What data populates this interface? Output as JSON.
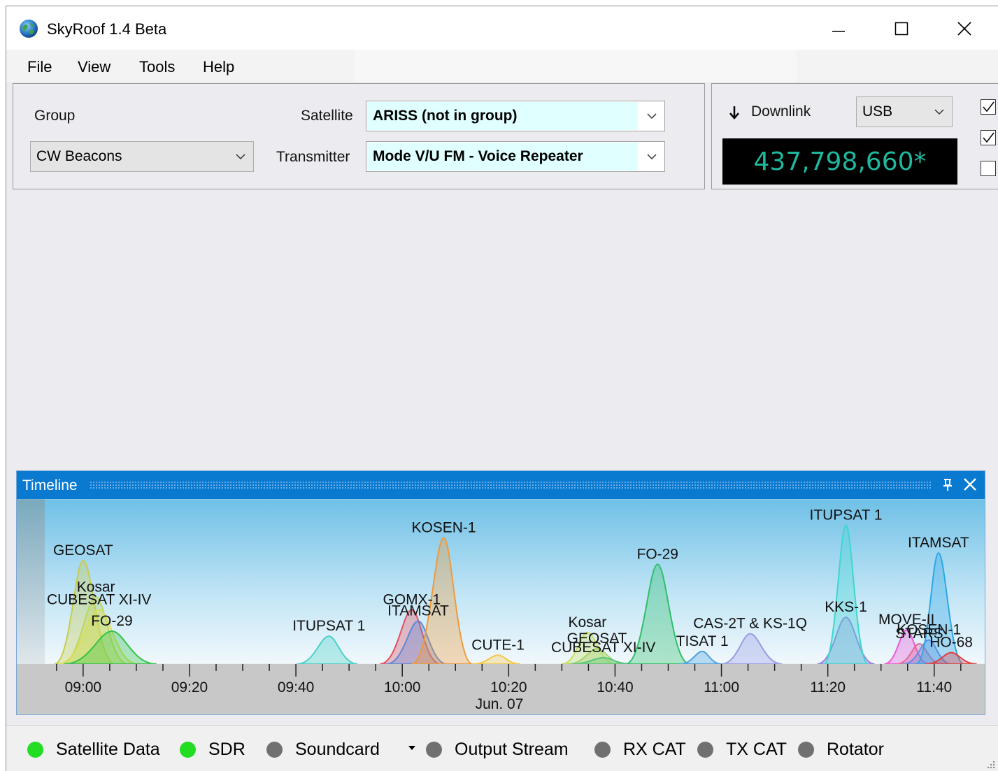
{
  "window": {
    "title": "SkyRoof 1.4 Beta"
  },
  "menu": [
    "File",
    "View",
    "Tools",
    "Help"
  ],
  "satellite_panel": {
    "group_label": "Group",
    "group_value": "CW Beacons",
    "satellite_label": "Satellite",
    "satellite_value": "ARISS (not in group)",
    "transmitter_label": "Transmitter",
    "transmitter_value": "Mode V/U FM - Voice Repeater"
  },
  "downlink_panel": {
    "label": "Downlink",
    "mode_value": "USB",
    "frequency": "437,798,660*",
    "checkboxes": [
      true,
      true,
      false
    ]
  },
  "timeline": {
    "title": "Timeline",
    "time_labels": [
      "09:00",
      "09:20",
      "09:40",
      "10:00",
      "10:20",
      "10:40",
      "11:00",
      "11:20",
      "11:40"
    ],
    "date_label": "Jun. 07",
    "passes": [
      {
        "name": "GEOSAT",
        "start": 8.91,
        "peak": 9.0,
        "end": 9.1,
        "elev": 0.82,
        "color": "#c8cc4a"
      },
      {
        "name": "Kosar",
        "start": 8.93,
        "peak": 9.04,
        "end": 9.14,
        "elev": 0.53,
        "color": "#b9d85a"
      },
      {
        "name": "CUBESAT XI-IV",
        "start": 8.92,
        "peak": 9.05,
        "end": 9.17,
        "elev": 0.43,
        "color": "#d8e05a"
      },
      {
        "name": "FO-29",
        "start": 8.94,
        "peak": 9.09,
        "end": 9.23,
        "elev": 0.26,
        "color": "#35c24a"
      },
      {
        "name": "ITUPSAT 1",
        "start": 9.67,
        "peak": 9.77,
        "end": 9.86,
        "elev": 0.22,
        "color": "#4bd0c7"
      },
      {
        "name": "GOMX-1",
        "start": 9.93,
        "peak": 10.03,
        "end": 10.12,
        "elev": 0.43,
        "color": "#e05060"
      },
      {
        "name": "ITAMSAT",
        "start": 9.95,
        "peak": 10.05,
        "end": 10.14,
        "elev": 0.34,
        "color": "#5d88d8"
      },
      {
        "name": "KOSEN-1",
        "start": 10.03,
        "peak": 10.13,
        "end": 10.22,
        "elev": 1.0,
        "color": "#f09a3a"
      },
      {
        "name": "CUTE-1",
        "start": 10.22,
        "peak": 10.3,
        "end": 10.37,
        "elev": 0.07,
        "color": "#f3c94a"
      },
      {
        "name": "Kosar",
        "start": 10.5,
        "peak": 10.58,
        "end": 10.67,
        "elev": 0.25,
        "color": "#c7e060"
      },
      {
        "name": "GEOSAT",
        "start": 10.52,
        "peak": 10.61,
        "end": 10.7,
        "elev": 0.12,
        "color": "#a4d26a"
      },
      {
        "name": "CUBESAT XI-IV",
        "start": 10.53,
        "peak": 10.63,
        "end": 10.72,
        "elev": 0.05,
        "color": "#57c57b"
      },
      {
        "name": "FO-29",
        "start": 10.7,
        "peak": 10.8,
        "end": 10.9,
        "elev": 0.79,
        "color": "#2fbf6a"
      },
      {
        "name": "TISAT 1",
        "start": 10.87,
        "peak": 10.94,
        "end": 11.0,
        "elev": 0.1,
        "color": "#4ca3e0"
      },
      {
        "name": "CAS-2T & KS-1Q",
        "start": 11.0,
        "peak": 11.09,
        "end": 11.19,
        "elev": 0.24,
        "color": "#9b9be6"
      },
      {
        "name": "KKS-1",
        "start": 11.3,
        "peak": 11.39,
        "end": 11.48,
        "elev": 0.37,
        "color": "#9a82e0"
      },
      {
        "name": "ITUPSAT 1",
        "start": 11.32,
        "peak": 11.39,
        "end": 11.46,
        "elev": 1.1,
        "color": "#3ed6d0"
      },
      {
        "name": "MOVE-II",
        "start": 11.51,
        "peak": 11.58,
        "end": 11.65,
        "elev": 0.27,
        "color": "#ec5ad8"
      },
      {
        "name": "STARS",
        "start": 11.55,
        "peak": 11.62,
        "end": 11.69,
        "elev": 0.16,
        "color": "#e06a9a"
      },
      {
        "name": "KOSEN-1",
        "start": 11.57,
        "peak": 11.65,
        "end": 11.72,
        "elev": 0.19,
        "color": "#6b8be0"
      },
      {
        "name": "ITAMSAT",
        "start": 11.61,
        "peak": 11.68,
        "end": 11.76,
        "elev": 0.88,
        "color": "#2fa6e6"
      },
      {
        "name": "HO-68",
        "start": 11.64,
        "peak": 11.72,
        "end": 11.8,
        "elev": 0.09,
        "color": "#e04040"
      }
    ]
  },
  "status": [
    {
      "label": "Satellite Data",
      "color": "#22dd22"
    },
    {
      "label": "SDR",
      "color": "#22dd22"
    },
    {
      "label": "Soundcard",
      "color": "#707070"
    },
    {
      "label": "Output Stream",
      "color": "#707070"
    },
    {
      "label": "RX CAT",
      "color": "#707070"
    },
    {
      "label": "TX CAT",
      "color": "#707070"
    },
    {
      "label": "Rotator",
      "color": "#707070"
    }
  ]
}
